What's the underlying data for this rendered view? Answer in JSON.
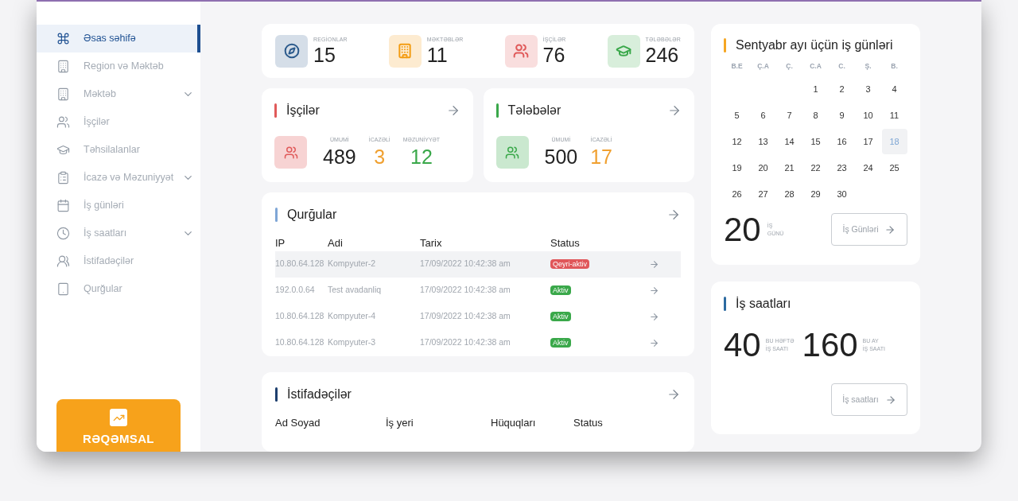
{
  "sidebar": {
    "items": [
      {
        "label": "Əsas səhifə",
        "selected": true,
        "expandable": false
      },
      {
        "label": "Region və Məktəb",
        "selected": false,
        "expandable": false
      },
      {
        "label": "Məktəb",
        "selected": false,
        "expandable": true
      },
      {
        "label": "İşçilər",
        "selected": false,
        "expandable": false
      },
      {
        "label": "Təhsilalanlar",
        "selected": false,
        "expandable": false
      },
      {
        "label": "İcazə və Məzuniyyət",
        "selected": false,
        "expandable": true
      },
      {
        "label": "İş günləri",
        "selected": false,
        "expandable": false
      },
      {
        "label": "İş saatları",
        "selected": false,
        "expandable": true
      },
      {
        "label": "İstifadəçilər",
        "selected": false,
        "expandable": false
      },
      {
        "label": "Qurğular",
        "selected": false,
        "expandable": false
      }
    ],
    "brand": "RƏQƏMSAL"
  },
  "stats": [
    {
      "label": "REGİONLAR",
      "value": "15",
      "color": "#2b5a8c"
    },
    {
      "label": "MƏKTƏBLƏR",
      "value": "11",
      "color": "#f39c12"
    },
    {
      "label": "İŞÇİLƏR",
      "value": "76",
      "color": "#e05a5a"
    },
    {
      "label": "TƏLƏBƏLƏR",
      "value": "246",
      "color": "#3aa84a"
    }
  ],
  "summary_cards": [
    {
      "title": "İşçilər",
      "color": "#e05a5a",
      "metrics": [
        {
          "label": "ÜMUMİ",
          "value": "489",
          "color": "#222222"
        },
        {
          "label": "İCAZƏLİ",
          "value": "3",
          "color": "#f0a030"
        },
        {
          "label": "MƏZUNİYYƏT",
          "value": "12",
          "color": "#3aa84a"
        }
      ]
    },
    {
      "title": "Tələbələr",
      "color": "#3aa84a",
      "metrics": [
        {
          "label": "ÜMUMİ",
          "value": "500",
          "color": "#222222"
        },
        {
          "label": "İCAZƏLİ",
          "value": "17",
          "color": "#f0a030"
        }
      ]
    }
  ],
  "devices": {
    "title": "Qurğular",
    "columns": [
      "IP",
      "Adi",
      "Tarix",
      "Status"
    ],
    "rows": [
      {
        "cells": [
          "10.80.64.128",
          "Kompyuter-2",
          "17/09/2022 10:42:38 am"
        ],
        "status": "Qeyri-aktiv",
        "kind": "inactive",
        "selected": true
      },
      {
        "cells": [
          "192.0.0.64",
          "Test avadanliq",
          "17/09/2022 10:42:38 am"
        ],
        "status": "Aktiv",
        "kind": "active",
        "selected": false
      },
      {
        "cells": [
          "10.80.64.128",
          "Kompyuter-4",
          "17/09/2022 10:42:38 am"
        ],
        "status": "Aktiv",
        "kind": "active",
        "selected": false
      },
      {
        "cells": [
          "10.80.64.128",
          "Kompyuter-3",
          "17/09/2022 10:42:38 am"
        ],
        "status": "Aktiv",
        "kind": "active",
        "selected": false
      }
    ]
  },
  "users": {
    "title": "İstifadəçilər",
    "columns": [
      "Ad Soyad",
      "İş yeri",
      "Hüquqları",
      "Status"
    ]
  },
  "calendar": {
    "title": "Sentyabr ayı üçün iş günləri",
    "weekdays": [
      "B.E",
      "Ç.A",
      "Ç.",
      "C.A",
      "C.",
      "Ş.",
      "B."
    ],
    "weeks": [
      {
        "right_aligned": true,
        "days": [
          {
            "label": "1",
            "selected": false
          },
          {
            "label": "2",
            "selected": false
          },
          {
            "label": "3",
            "selected": false
          },
          {
            "label": "4",
            "selected": false
          }
        ]
      },
      {
        "days": [
          {
            "label": "5",
            "selected": false
          },
          {
            "label": "6",
            "selected": false
          },
          {
            "label": "7",
            "selected": false
          },
          {
            "label": "8",
            "selected": false
          },
          {
            "label": "9",
            "selected": false
          },
          {
            "label": "10",
            "selected": false
          },
          {
            "label": "11",
            "selected": false
          }
        ]
      },
      {
        "days": [
          {
            "label": "12",
            "selected": false
          },
          {
            "label": "13",
            "selected": false
          },
          {
            "label": "14",
            "selected": false
          },
          {
            "label": "15",
            "selected": false
          },
          {
            "label": "16",
            "selected": false
          },
          {
            "label": "17",
            "selected": false
          },
          {
            "label": "18",
            "selected": true
          }
        ]
      },
      {
        "days": [
          {
            "label": "19",
            "selected": false
          },
          {
            "label": "20",
            "selected": false
          },
          {
            "label": "21",
            "selected": false
          },
          {
            "label": "22",
            "selected": false
          },
          {
            "label": "23",
            "selected": false
          },
          {
            "label": "24",
            "selected": false
          },
          {
            "label": "25",
            "selected": false
          }
        ]
      },
      {
        "right_aligned": false,
        "days": [
          {
            "label": "26",
            "selected": false
          },
          {
            "label": "27",
            "selected": false
          },
          {
            "label": "28",
            "selected": false
          },
          {
            "label": "29",
            "selected": false
          },
          {
            "label": "30",
            "selected": false
          }
        ]
      }
    ],
    "count": "20",
    "count_label": [
      "İŞ",
      "GÜNÜ"
    ],
    "button": "İş Günləri"
  },
  "hours": {
    "title": "İş saatları",
    "items": [
      {
        "value": "40",
        "label": [
          "BU HƏFTƏ",
          "İŞ SAATI"
        ]
      },
      {
        "value": "160",
        "label": [
          "BU AY",
          "İŞ SAATI"
        ]
      }
    ],
    "button": "İş saatları"
  }
}
